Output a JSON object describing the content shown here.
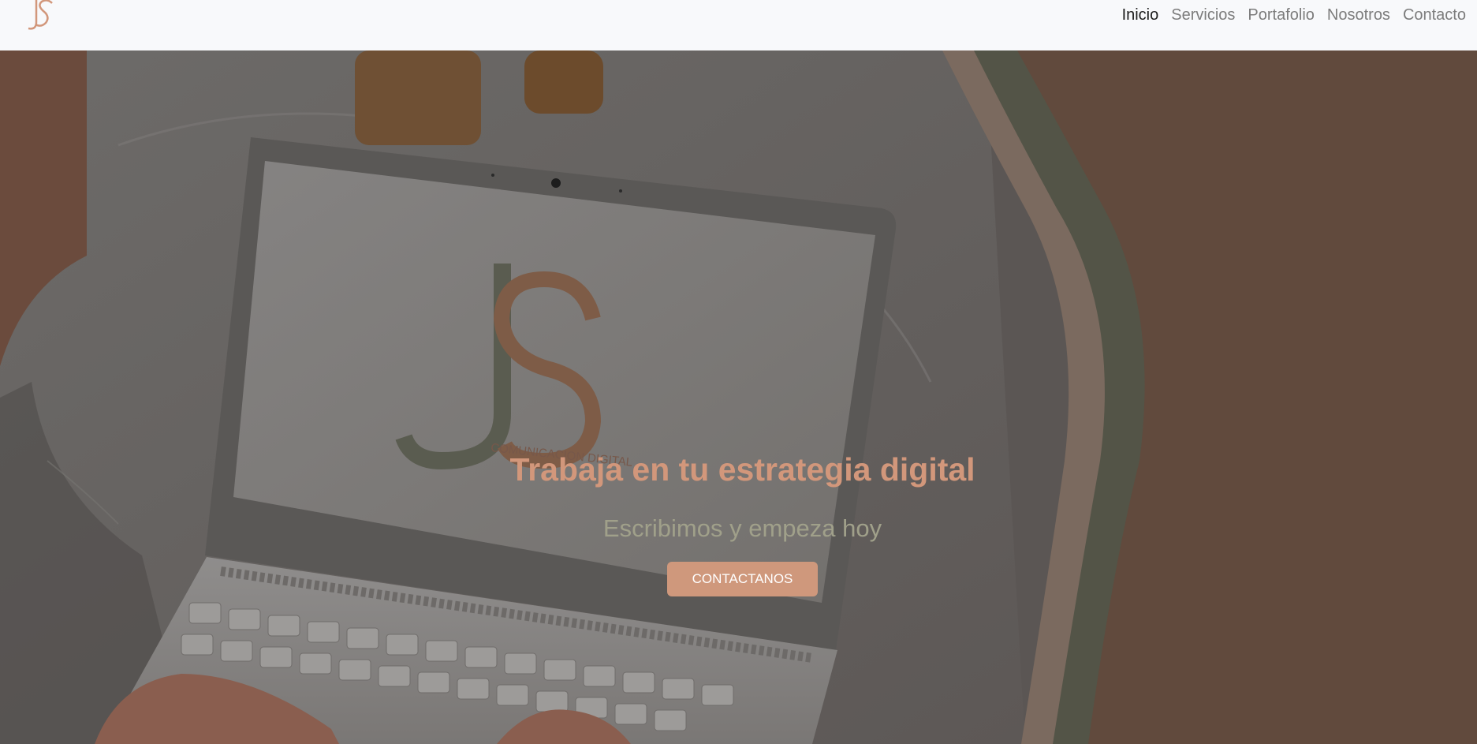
{
  "brand": {
    "logo_text": "JS",
    "accent": "#cf987c",
    "secondary": "#5a5c50"
  },
  "nav": {
    "items": [
      {
        "label": "Inicio",
        "active": true
      },
      {
        "label": "Servicios",
        "active": false
      },
      {
        "label": "Portafolio",
        "active": false
      },
      {
        "label": "Nosotros",
        "active": false
      },
      {
        "label": "Contacto",
        "active": false
      }
    ]
  },
  "hero": {
    "title": "Trabaja en tu estrategia digital",
    "subtitle": "Escribimos y empeza hoy",
    "cta_label": "CONTACTANOS",
    "screen_logo": "JS",
    "screen_logo_caption": "COMUNICACION DIGITAL",
    "panel_color": "#614a3d"
  }
}
